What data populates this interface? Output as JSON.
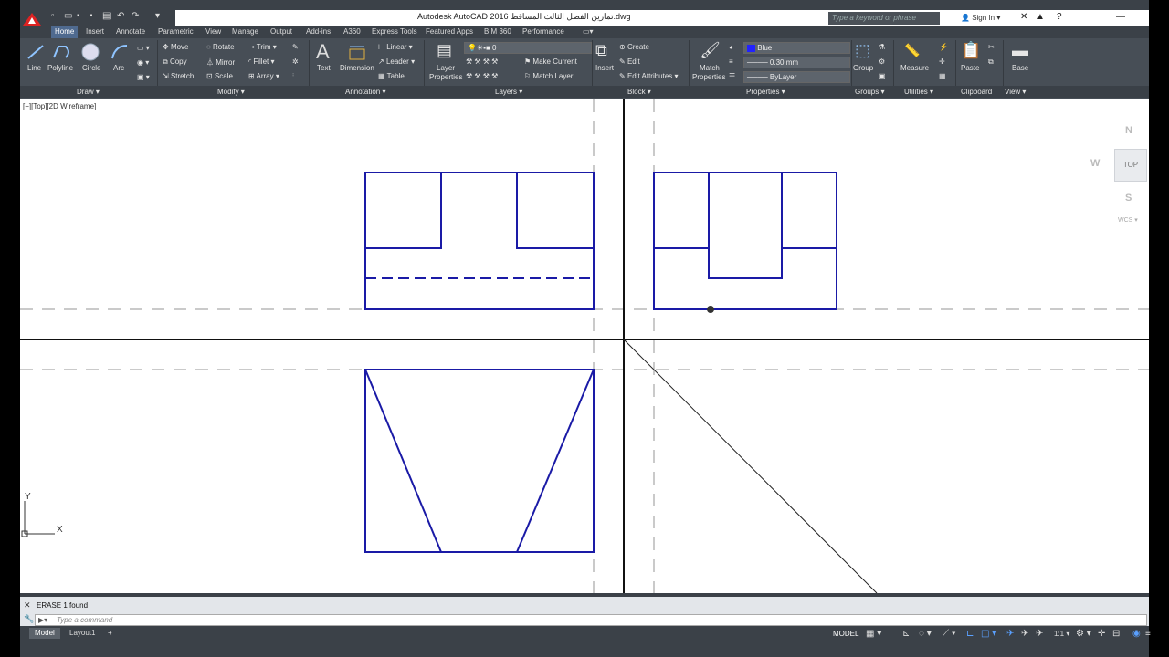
{
  "app": {
    "title": "Autodesk AutoCAD 2016   تمارين الفصل الثالث المساقط.dwg",
    "search_placeholder": "Type a keyword or phrase",
    "sign_in": "Sign In"
  },
  "tabs": [
    "Home",
    "Insert",
    "Annotate",
    "Parametric",
    "View",
    "Manage",
    "Output",
    "Add-ins",
    "A360",
    "Express Tools",
    "Featured Apps",
    "BIM 360",
    "Performance"
  ],
  "active_tab": "Home",
  "ribbon": {
    "draw": {
      "line": "Line",
      "polyline": "Polyline",
      "circle": "Circle",
      "arc": "Arc",
      "panel": "Draw ▾"
    },
    "modify": {
      "move": "Move",
      "rotate": "Rotate",
      "trim": "Trim",
      "copy": "Copy",
      "mirror": "Mirror",
      "fillet": "Fillet",
      "stretch": "Stretch",
      "scale": "Scale",
      "array": "Array",
      "panel": "Modify ▾"
    },
    "annotation": {
      "text": "Text",
      "dimension": "Dimension",
      "linear": "Linear",
      "leader": "Leader",
      "table": "Table",
      "panel": "Annotation ▾"
    },
    "layers": {
      "layer_properties_1": "Layer",
      "layer_properties_2": "Properties",
      "current_layer": "0",
      "make_current": "Make Current",
      "match_layer": "Match Layer",
      "panel": "Layers ▾"
    },
    "block": {
      "insert": "Insert",
      "create": "Create",
      "edit": "Edit",
      "edit_attributes": "Edit Attributes",
      "panel": "Block ▾"
    },
    "properties": {
      "match_1": "Match",
      "match_2": "Properties",
      "color": "Blue",
      "lineweight": "0.30 mm",
      "linetype": "ByLayer",
      "panel": "Properties ▾"
    },
    "groups": {
      "group": "Group",
      "panel": "Groups ▾"
    },
    "utilities": {
      "measure": "Measure",
      "panel": "Utilities ▾"
    },
    "clipboard": {
      "paste": "Paste",
      "panel": "Clipboard"
    },
    "view": {
      "base": "Base",
      "panel": "View ▾"
    }
  },
  "viewport": {
    "label": "[−][Top][2D Wireframe]",
    "viewcube": {
      "n": "N",
      "s": "S",
      "w": "W",
      "top": "TOP",
      "wcs": "WCS ▾"
    },
    "ucs": {
      "x": "X",
      "y": "Y"
    }
  },
  "command": {
    "history": "ERASE  1  found",
    "placeholder": "Type  a  command"
  },
  "status": {
    "layouts": [
      "Model",
      "Layout1"
    ],
    "add": "+",
    "model": "MODEL",
    "scale": "1:1 ▾"
  },
  "colors": {
    "drawing": "#1a1aa6",
    "accent": "#4f6a8f",
    "ribbon": "#474e56",
    "frame": "#3b4148"
  }
}
